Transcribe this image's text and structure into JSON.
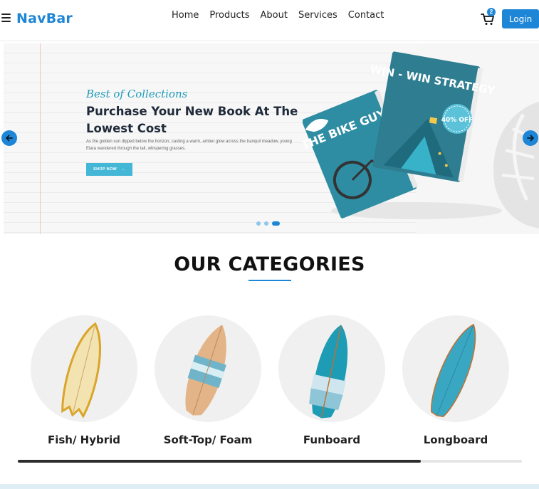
{
  "navbar": {
    "brand": "NavBar",
    "links": [
      "Home",
      "Products",
      "About",
      "Services",
      "Contact"
    ],
    "cart_count": "2",
    "login_label": "Login"
  },
  "hero": {
    "script_text": "Best of Collections",
    "title": "Purchase Your New Book At The Lowest Cost",
    "description": "As the golden sun dipped below the horizon, casting a warm, amber glow across the tranquil meadow, young Elara wandered through the tall, whispering grasses.",
    "button_label": "SHOP NOW",
    "book1_title": "THE BIKE GUY",
    "book2_title": "WIN - WIN STRATEGY",
    "discount": "40% OFF",
    "slides": 3,
    "active_slide": 3
  },
  "categories": {
    "title": "OUR CATEGORIES",
    "items": [
      {
        "label": "Fish/ Hybrid"
      },
      {
        "label": "Soft-Top/ Foam"
      },
      {
        "label": "Funboard"
      },
      {
        "label": "Longboard"
      }
    ],
    "scroll_progress": 0.8
  },
  "colors": {
    "accent": "#1e86d6",
    "teal": "#2e8fa5",
    "script": "#1e9bb8",
    "shop_button": "#45b7d6"
  },
  "icons": {
    "menu": "hamburger-icon",
    "cart": "cart-icon",
    "prev": "arrow-left-icon",
    "next": "arrow-right-icon"
  }
}
